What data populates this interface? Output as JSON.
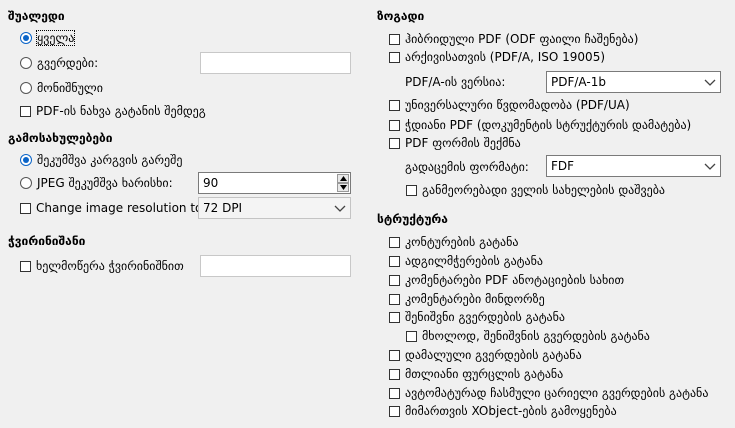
{
  "range": {
    "heading": "შუალედი",
    "all_label": "ყველა",
    "pages_label": "გვერდები:",
    "pages_value": "",
    "selection_label": "მონიშნული",
    "view_after_export_label": "PDF-ის ნახვა გატანის შემდეგ"
  },
  "images": {
    "heading": "გამოსახულებები",
    "lossless_label": "შეკუმშვა კარგვის გარეშე",
    "jpeg_label": "JPEG შეკუმშვა  ხარისხი:",
    "jpeg_quality": "90",
    "resolution_label": "Change image resolution to:",
    "resolution_value": "72 DPI"
  },
  "watermark": {
    "heading": "ჭვირინიშანი",
    "sign_label": "ხელმოწერა ჭვირინიშნით",
    "sign_value": ""
  },
  "general": {
    "heading": "ზოგადი",
    "hybrid_label": "ჰიბრიდული PDF (ODF ფაილი ჩაშენება)",
    "archive_label": "არქივისათვის (PDF/A, ISO 19005)",
    "pdfa_version_label": "PDF/A-ის ვერსია:",
    "pdfa_version_value": "PDF/A-1b",
    "ua_label": "უნივერსალური წვდომადობა (PDF/UA)",
    "tagged_label": "ჭდიანი PDF (დოკუმენტის სტრუქტურის დამატება)",
    "form_label": "PDF ფორმის შექმნა",
    "submit_format_label": "გადაცემის ფორმატი:",
    "submit_format_value": "FDF",
    "dup_names_label": "განმეორებადი ველის სახელების დაშვება"
  },
  "structure": {
    "heading": "სტრუქტურა",
    "items": [
      "კონტურების გატანა",
      "ადგილმჭერების გატანა",
      "კომენტარები PDF ანოტაციების სახით",
      "კომენტარები მინდორზე",
      "შენიშვნი გვერდების გატანა",
      "მხოლოდ, შენიშვნის გვერდების გატანა",
      "დამალული გვერდების გატანა",
      "მთლიანი ფურცლის გატანა",
      "ავტომატურად ჩასმული ცარიელი გვერდების გატანა",
      "მიმართვის XObject-ების გამოყენება"
    ]
  }
}
